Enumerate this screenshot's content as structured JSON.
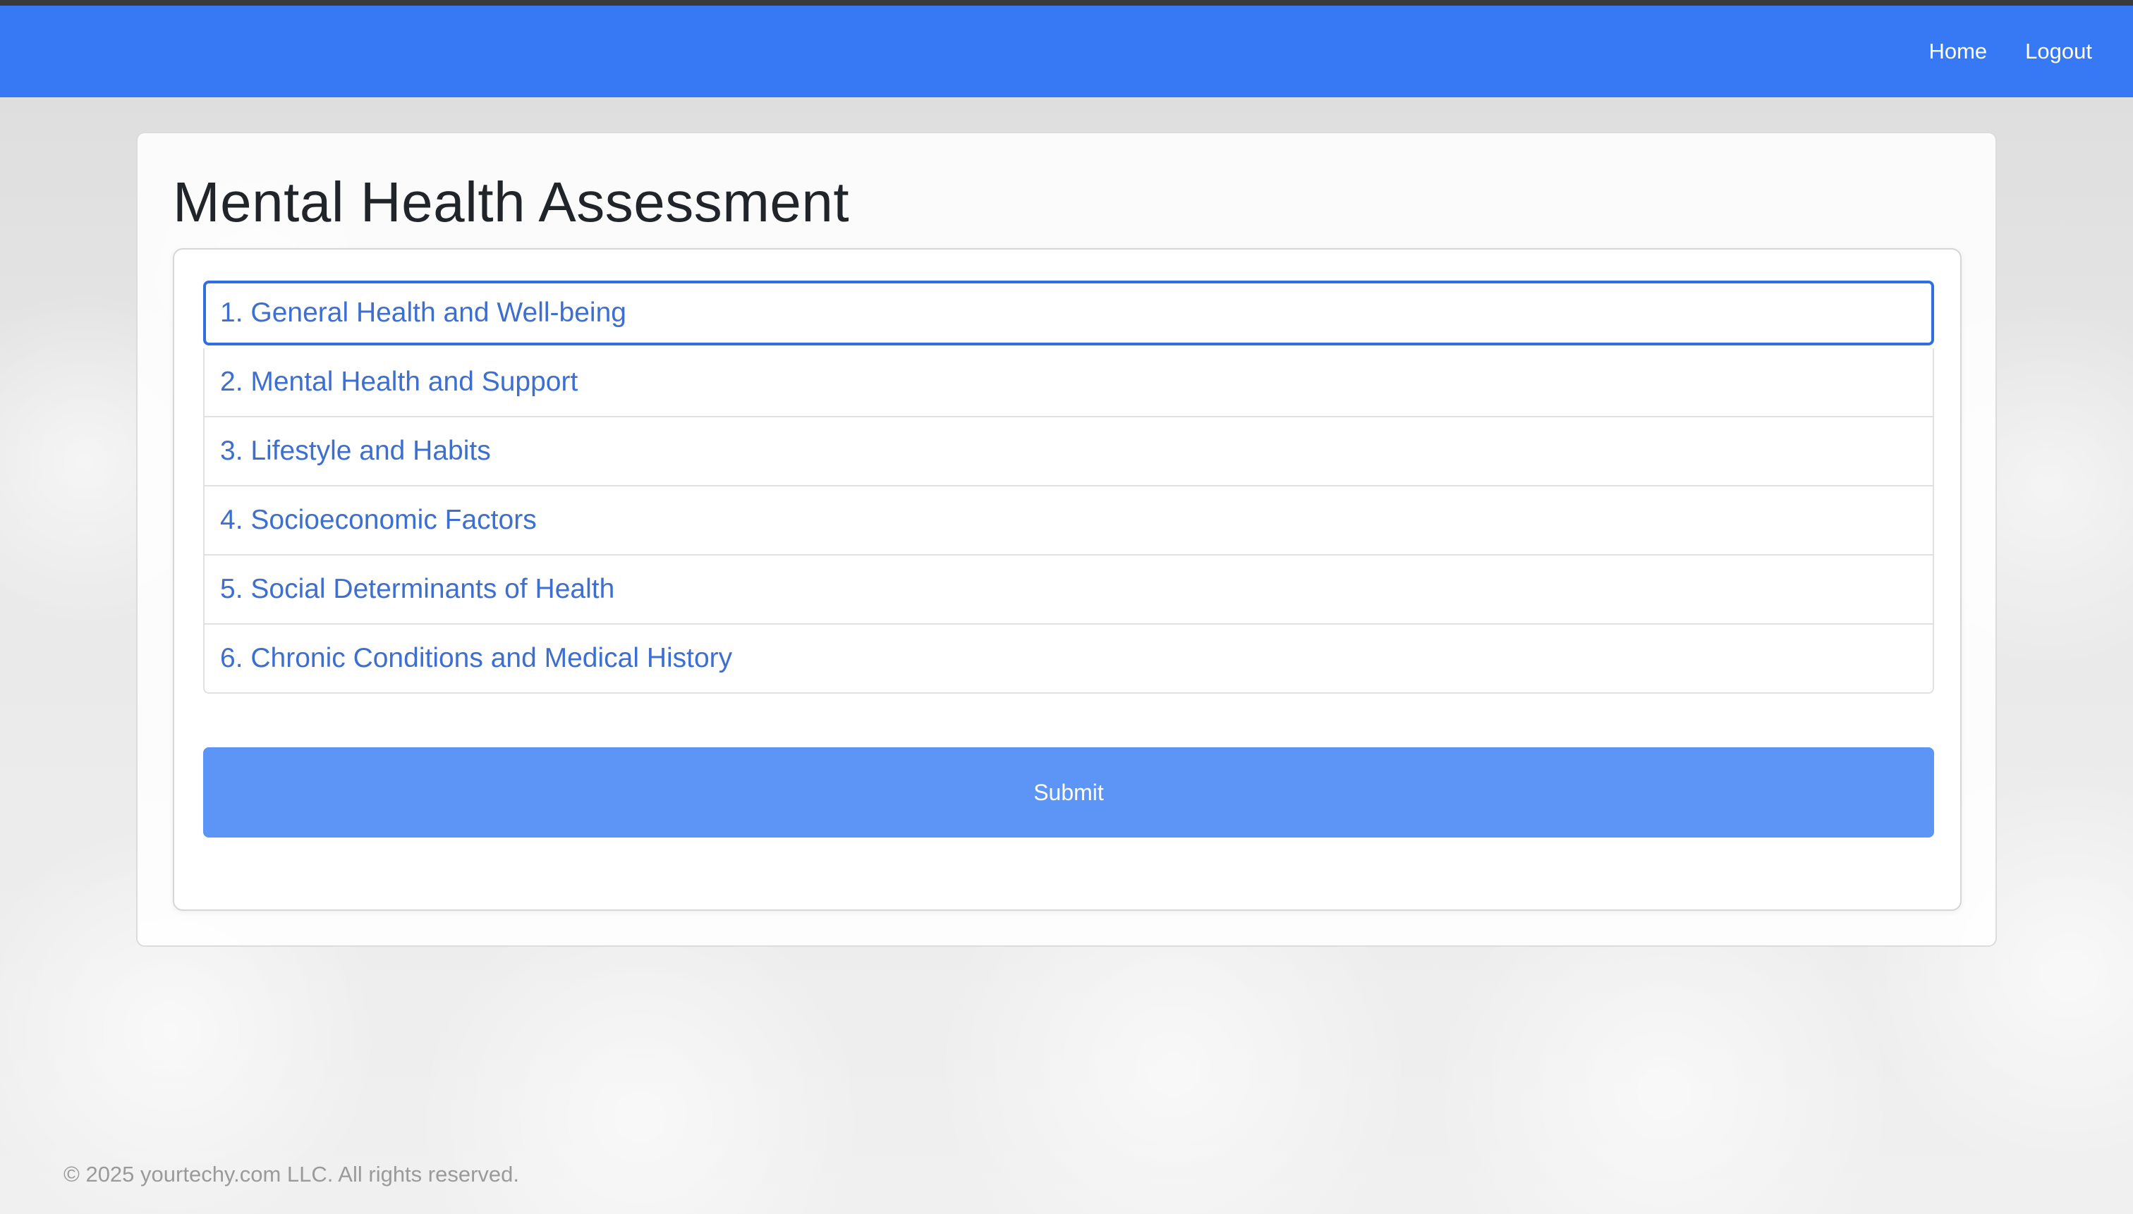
{
  "navbar": {
    "home_label": "Home",
    "logout_label": "Logout",
    "color": "#3779f5"
  },
  "page": {
    "title": "Mental Health Assessment"
  },
  "sections": [
    {
      "label": "1. General Health and Well-being",
      "active": true
    },
    {
      "label": "2. Mental Health and Support",
      "active": false
    },
    {
      "label": "3. Lifestyle and Habits",
      "active": false
    },
    {
      "label": "4. Socioeconomic Factors",
      "active": false
    },
    {
      "label": "5. Social Determinants of Health",
      "active": false
    },
    {
      "label": "6. Chronic Conditions and Medical History",
      "active": false
    }
  ],
  "form": {
    "submit_label": "Submit",
    "submit_color": "#5d95f6"
  },
  "footer": {
    "copyright": "© 2025 yourtechy.com LLC. All rights reserved."
  }
}
